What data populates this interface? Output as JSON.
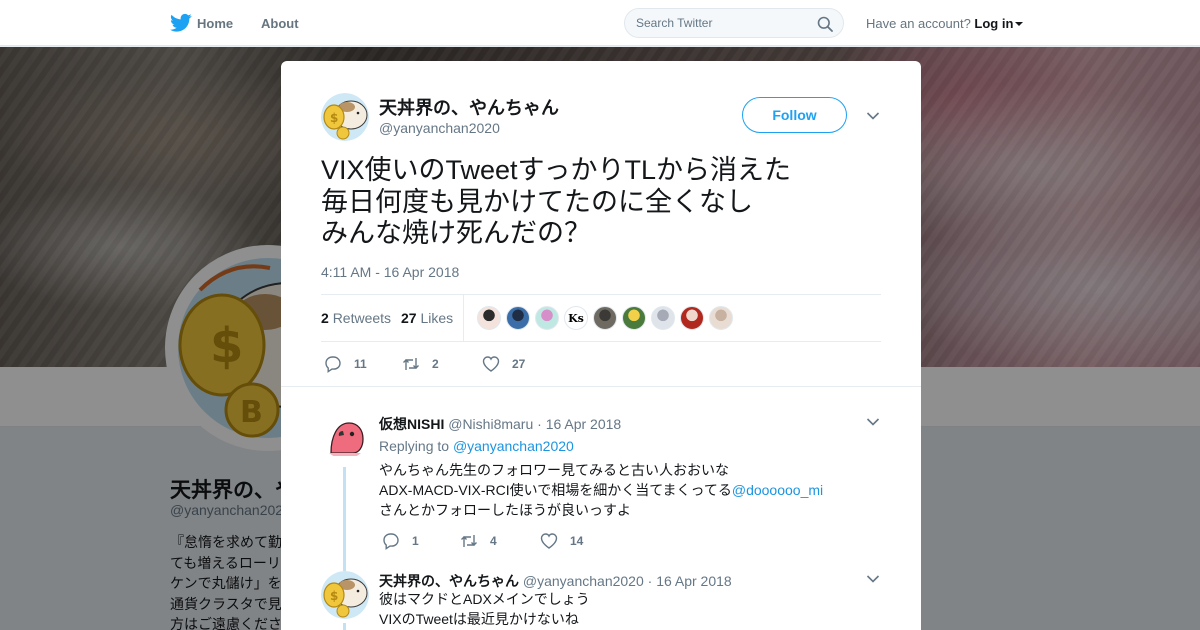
{
  "nav": {
    "home_label": "Home",
    "about_label": "About",
    "search_placeholder": "Search Twitter",
    "account_prompt": "Have an account?",
    "login_label": "Log in"
  },
  "profile": {
    "name": "天丼界の、や",
    "handle": "@yanyanchan2020",
    "bio": "『怠惰を求めて勤\nても増えるローリ\nケンで丸儲け」を\n通貨クラスタで見\n方はご遠慮くださ"
  },
  "tweet": {
    "author_name": "天丼界の、やんちゃん",
    "author_handle": "@yanyanchan2020",
    "follow_label": "Follow",
    "text": "VIX使いのTweetすっかりTLから消えた\n毎日何度も見かけてたのに全くなし\nみんな焼け死んだの？",
    "timestamp": "4:11 AM - 16 Apr 2018",
    "retweet_count": "2",
    "retweet_label": "Retweets",
    "like_count": "27",
    "like_label": "Likes",
    "actions": {
      "replies": "11",
      "retweets": "2",
      "likes": "27"
    }
  },
  "likers": [
    {
      "color": "#f4e3dc",
      "fg": "#2c2c2c"
    },
    {
      "color": "#3b6ea8",
      "fg": "#1f2e44"
    },
    {
      "color": "#bfe8e2",
      "fg": "#d68fc9"
    },
    {
      "color": "#ffffff",
      "fg": "#000000",
      "text": "Ks"
    },
    {
      "color": "#6e6a62",
      "fg": "#3c3a36"
    },
    {
      "color": "#4a7a3c",
      "fg": "#f2d04a"
    },
    {
      "color": "#dfe3ea",
      "fg": "#a5aab6"
    },
    {
      "color": "#b0281e",
      "fg": "#f0d7cc"
    },
    {
      "color": "#e9ddd3",
      "fg": "#c7b1a0"
    }
  ],
  "replies": [
    {
      "name": "仮想NISHI",
      "handle": "@Nishi8maru",
      "date": "· 16 Apr 2018",
      "replying_prefix": "Replying to",
      "replying_to": "@yanyanchan2020",
      "line1": "やんちゃん先生のフォロワー見てみると古い人おおいな",
      "line2": "ADX-MACD-VIX-RCI使いで相場を細かく当てまくってる",
      "mention": "@doooooo_mi",
      "line3": "さんとかフォローしたほうが良いっすよ",
      "actions": {
        "replies": "1",
        "retweets": "4",
        "likes": "14"
      }
    },
    {
      "name": "天丼界の、やんちゃん",
      "handle": "@yanyanchan2020",
      "date": "· 16 Apr 2018",
      "line1": "彼はマクドとADXメインでしょう",
      "line2": "VIXのTweetは最近見かけないね"
    }
  ],
  "colors": {
    "accent": "#1da1f2",
    "link": "#1b95e0",
    "muted": "#657786",
    "overlay": "rgba(0,0,0,0.44)"
  }
}
